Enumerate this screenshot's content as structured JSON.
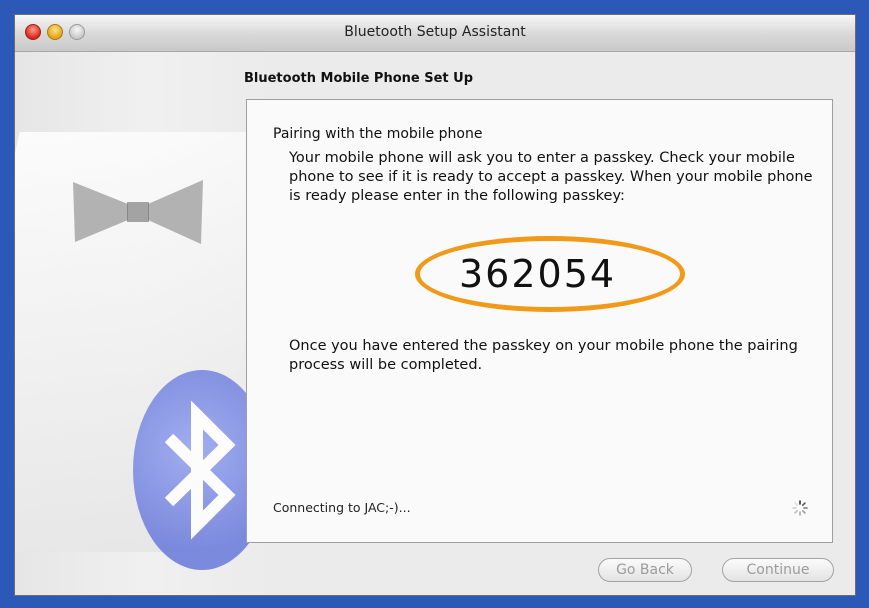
{
  "window": {
    "title": "Bluetooth Setup Assistant"
  },
  "content": {
    "section_title": "Bluetooth Mobile Phone Set Up",
    "pairing_heading": "Pairing with the mobile phone",
    "instructions": "Your mobile phone will ask you to enter a passkey. Check your mobile phone to see if it is ready to accept a passkey. When your mobile phone is ready please enter in the following passkey:",
    "passkey": "362054",
    "completion_note": "Once you have entered the passkey on your mobile phone the pairing process will be completed.",
    "status": "Connecting to JAC;-)..."
  },
  "buttons": {
    "go_back": "Go Back",
    "continue": "Continue"
  },
  "colors": {
    "desktop_background": "#2c58b8",
    "highlight_oval": "#f19a1a",
    "bluetooth_logo": "#7080dc"
  },
  "icons": {
    "window_controls": [
      "close-button-icon",
      "minimize-button-icon",
      "zoom-button-icon"
    ],
    "progress": "spinner-icon",
    "artwork": "bluetooth-logo-icon"
  }
}
